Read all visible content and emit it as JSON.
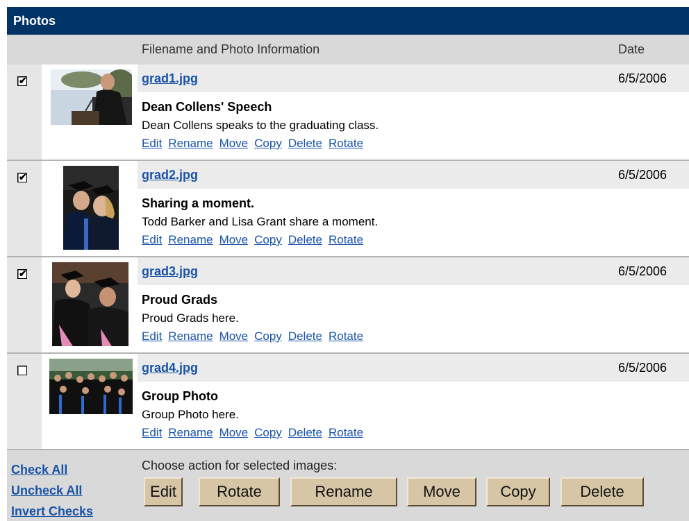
{
  "panel": {
    "title": "Photos",
    "col_file": "Filename and Photo Information",
    "col_date": "Date"
  },
  "photos": [
    {
      "checked": true,
      "filename": "grad1.jpg",
      "date": "6/5/2006",
      "title": "Dean Collens' Speech",
      "description": "Dean Collens speaks to the graduating class.",
      "thumb_icon": "speech-photo-icon"
    },
    {
      "checked": true,
      "filename": "grad2.jpg",
      "date": "6/5/2006",
      "title": "Sharing a moment.",
      "description": "Todd Barker and Lisa Grant share a moment.",
      "thumb_icon": "couple-photo-icon"
    },
    {
      "checked": true,
      "filename": "grad3.jpg",
      "date": "6/5/2006",
      "title": "Proud Grads",
      "description": "Proud Grads here.",
      "thumb_icon": "grads-photo-icon"
    },
    {
      "checked": false,
      "filename": "grad4.jpg",
      "date": "6/5/2006",
      "title": "Group Photo",
      "description": "Group Photo here.",
      "thumb_icon": "group-photo-icon"
    }
  ],
  "row_actions": {
    "edit": "Edit",
    "rename": "Rename",
    "move": "Move",
    "copy": "Copy",
    "delete": "Delete",
    "rotate": "Rotate"
  },
  "footer": {
    "check_all": "Check All",
    "uncheck_all": "Uncheck All",
    "invert_checks": "Invert Checks",
    "prompt": "Choose action for selected images:",
    "buttons": {
      "edit": "Edit",
      "rotate": "Rotate",
      "rename": "Rename",
      "move": "Move",
      "copy": "Copy",
      "delete": "Delete"
    }
  },
  "colors": {
    "title_bar": "#003366",
    "link": "#1a53a8",
    "button_face": "#d6c6a6"
  }
}
